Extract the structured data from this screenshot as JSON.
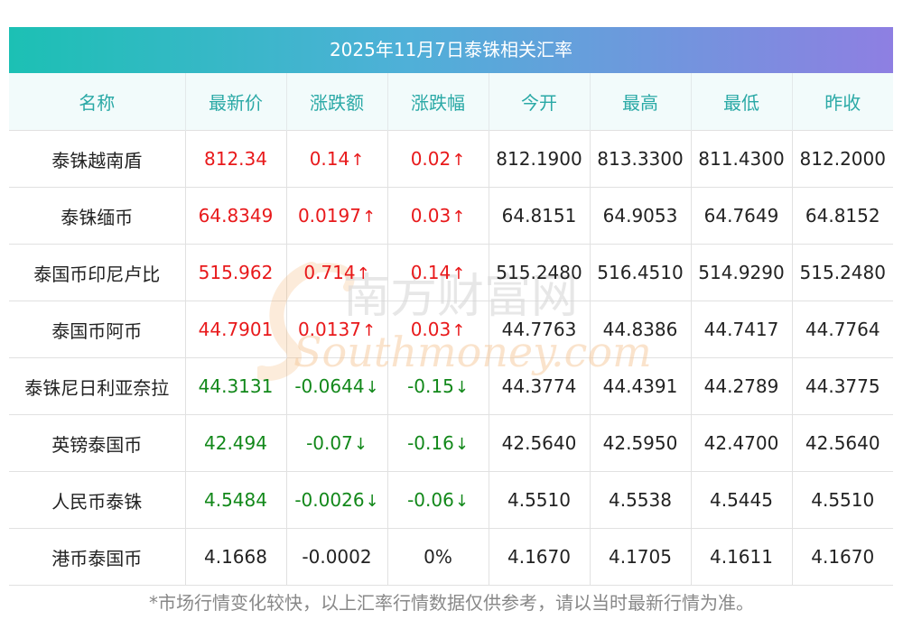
{
  "title": "2025年11月7日泰铢相关汇率",
  "headers": [
    "名称",
    "最新价",
    "涨跌额",
    "涨跌幅",
    "今开",
    "最高",
    "最低",
    "昨收"
  ],
  "rows": [
    {
      "name": "泰铢越南盾",
      "latest": "812.34",
      "change": "0.14",
      "change_pct": "0.02",
      "trend": "up",
      "arrow": "↑",
      "open": "812.1900",
      "high": "813.3300",
      "low": "811.4300",
      "prev_close": "812.2000"
    },
    {
      "name": "泰铢缅币",
      "latest": "64.8349",
      "change": "0.0197",
      "change_pct": "0.03",
      "trend": "up",
      "arrow": "↑",
      "open": "64.8151",
      "high": "64.9053",
      "low": "64.7649",
      "prev_close": "64.8152"
    },
    {
      "name": "泰国币印尼卢比",
      "latest": "515.962",
      "change": "0.714",
      "change_pct": "0.14",
      "trend": "up",
      "arrow": "↑",
      "open": "515.2480",
      "high": "516.4510",
      "low": "514.9290",
      "prev_close": "515.2480"
    },
    {
      "name": "泰国币阿币",
      "latest": "44.7901",
      "change": "0.0137",
      "change_pct": "0.03",
      "trend": "up",
      "arrow": "↑",
      "open": "44.7763",
      "high": "44.8386",
      "low": "44.7417",
      "prev_close": "44.7764"
    },
    {
      "name": "泰铢尼日利亚奈拉",
      "latest": "44.3131",
      "change": "-0.0644",
      "change_pct": "-0.15",
      "trend": "down",
      "arrow": "↓",
      "open": "44.3774",
      "high": "44.4391",
      "low": "44.2789",
      "prev_close": "44.3775"
    },
    {
      "name": "英镑泰国币",
      "latest": "42.494",
      "change": "-0.07",
      "change_pct": "-0.16",
      "trend": "down",
      "arrow": "↓",
      "open": "42.5640",
      "high": "42.5950",
      "low": "42.4700",
      "prev_close": "42.5640"
    },
    {
      "name": "人民币泰铢",
      "latest": "4.5484",
      "change": "-0.0026",
      "change_pct": "-0.06",
      "trend": "down",
      "arrow": "↓",
      "open": "4.5510",
      "high": "4.5538",
      "low": "4.5445",
      "prev_close": "4.5510"
    },
    {
      "name": "港币泰国币",
      "latest": "4.1668",
      "change": "-0.0002",
      "change_pct": "0%",
      "trend": "flat",
      "arrow": "",
      "open": "4.1670",
      "high": "4.1705",
      "low": "4.1611",
      "prev_close": "4.1670"
    }
  ],
  "watermark": {
    "cn": "南方财富网",
    "en": "Southmoney.com"
  },
  "footnote": "*市场行情变化较快，以上汇率行情数据仅供参考，请以当时最新行情为准。",
  "colors": {
    "up": "#e8191b",
    "down": "#12881a",
    "header_text": "#2aa9a6",
    "gradient_start": "#1cc0b4",
    "gradient_end": "#8e7fe2"
  }
}
